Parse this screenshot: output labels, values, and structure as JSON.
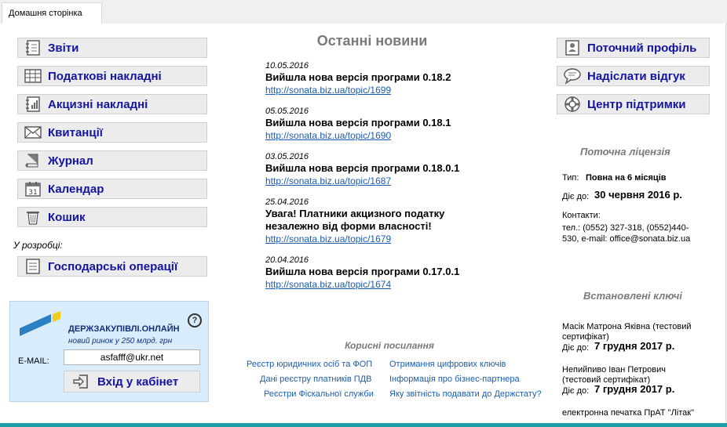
{
  "tab": {
    "label": "Домашня сторінка"
  },
  "nav": {
    "items": [
      {
        "label": "Звіти"
      },
      {
        "label": "Податкові накладні"
      },
      {
        "label": "Акцизні накладні"
      },
      {
        "label": "Квитанції"
      },
      {
        "label": "Журнал"
      },
      {
        "label": "Календар"
      },
      {
        "label": "Кошик"
      }
    ],
    "dev_note": "У розробці:",
    "dev_item": {
      "label": "Господарські операції"
    }
  },
  "promo": {
    "brand": "ДЕРЖЗАКУПІВЛІ.ОНЛАЙН",
    "tagline": "новий ринок у 250 млрд. грн",
    "email_label": "E-MAIL:",
    "email_value": "asfafff@ukr.net",
    "login_label": "Вхід у кабінет",
    "help": "?"
  },
  "news": {
    "title": "Останні новини",
    "items": [
      {
        "date": "10.05.2016",
        "head": "Вийшла нова версія програми 0.18.2",
        "link": "http://sonata.biz.ua/topic/1699"
      },
      {
        "date": "05.05.2016",
        "head": "Вийшла нова версія програми 0.18.1",
        "link": "http://sonata.biz.ua/topic/1690"
      },
      {
        "date": "03.05.2016",
        "head": "Вийшла нова версія програми 0.18.0.1",
        "link": "http://sonata.biz.ua/topic/1687"
      },
      {
        "date": "25.04.2016",
        "head1": "Увага! Платники акцизного податку",
        "head2": "незалежно від форми власності!",
        "link": "http://sonata.biz.ua/topic/1679"
      },
      {
        "date": "20.04.2016",
        "head": "Вийшла нова версія програми 0.17.0.1",
        "link": "http://sonata.biz.ua/topic/1674"
      }
    ]
  },
  "links": {
    "title": "Корисні посилання",
    "left": [
      "Реєстр юридичних осіб та ФОП",
      "Дані реєстру платників ПДВ",
      "Реєстри Фіскальної служби"
    ],
    "right": [
      "Отримання цифрових ключів",
      "Інформація про бізнес-партнера",
      "Яку звітність подавати до Держстату?"
    ]
  },
  "right_nav": [
    {
      "label": "Поточний профіль"
    },
    {
      "label": "Надіслати відгук"
    },
    {
      "label": "Центр підтримки"
    }
  ],
  "license": {
    "title": "Поточна ліцензія",
    "type_label": "Тип:",
    "type_value": "Повна на 6 місяців",
    "valid_label": "Діє до:",
    "valid_value": "30 червня 2016 р.",
    "contacts_label": "Контакти:",
    "phone_line1": "тел.: (0552) 327-318, (0552)440-",
    "phone_line2": "530, e-mail: office@sonata.biz.ua"
  },
  "keys": {
    "title": "Встановлені ключі",
    "items": [
      {
        "name1": "Масік Матрона Яківна (тестовий",
        "name2": "сертифікат)",
        "valid_label": "Діє до:",
        "valid_value": "7 грудня 2017 р."
      },
      {
        "name1": "Непийпиво Іван Петрович",
        "name2": "(тестовий сертифікат)",
        "valid_label": "Діє до:",
        "valid_value": "7 грудня 2017 р."
      }
    ],
    "seal": "електронна печатка ПрАТ \"Літак\""
  }
}
